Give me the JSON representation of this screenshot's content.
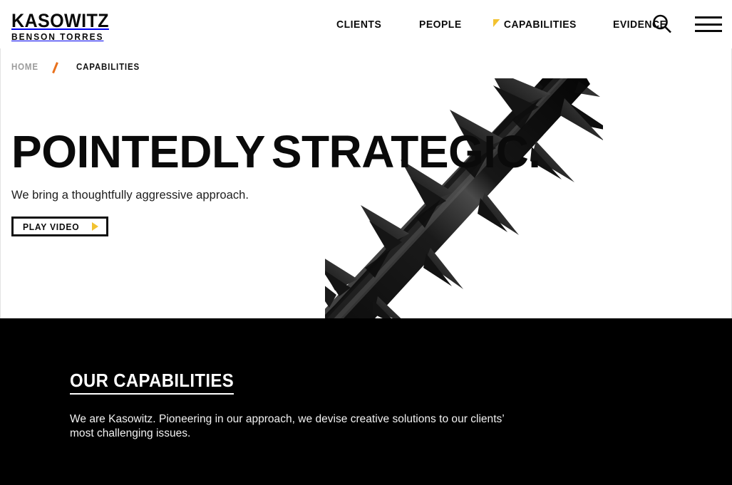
{
  "brand": {
    "name_main": "KASOWITZ",
    "name_sub": "BENSON TORRES",
    "accent_yellow": "#F2C230",
    "accent_orange": "#E9711C",
    "dark": "#000000"
  },
  "header": {
    "nav": [
      {
        "label": "CLIENTS",
        "active": false
      },
      {
        "label": "PEOPLE",
        "active": false
      },
      {
        "label": "CAPABILITIES",
        "active": true
      },
      {
        "label": "EVIDENCE",
        "active": false
      }
    ],
    "icons": {
      "search": "search-icon",
      "menu": "hamburger-menu-icon"
    }
  },
  "breadcrumb": {
    "home": "HOME",
    "separator": "/",
    "current": "CAPABILITIES"
  },
  "hero": {
    "title_line1": "POINTEDLY",
    "title_line2": "STRATEGIC.",
    "subtitle": "We bring a thoughtfully aggressive approach.",
    "play_button": {
      "label": "PLAY VIDEO",
      "icon": "play-triangle-icon"
    },
    "image": "thorn-branch-photograph"
  },
  "capabilities_section": {
    "heading": "OUR CAPABILITIES",
    "body": "We are Kasowitz. Pioneering in our approach, we devise creative solutions to our clients’ most challenging issues."
  }
}
